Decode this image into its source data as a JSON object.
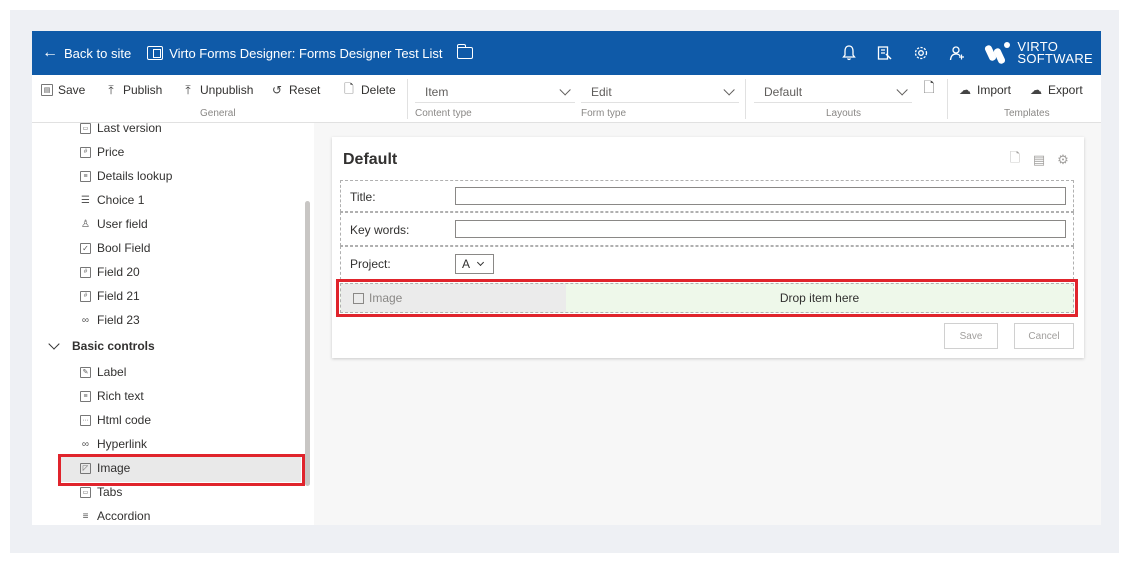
{
  "topbar": {
    "back_label": "Back to site",
    "title": "Virto Forms Designer: Forms Designer Test List",
    "icons": [
      "bell-icon",
      "reader-icon",
      "gear-icon",
      "person-icon"
    ],
    "logo_line1": "VIRTO",
    "logo_line2": "SOFTWARE",
    "background": "#0f5aa8"
  },
  "ribbon": {
    "general": {
      "title": "General",
      "save": "Save",
      "publish": "Publish",
      "unpublish": "Unpublish",
      "reset": "Reset",
      "delete": "Delete"
    },
    "content_type": {
      "title": "Content type",
      "value": "Item"
    },
    "form_type": {
      "title": "Form type",
      "value": "Edit"
    },
    "layouts": {
      "title": "Layouts",
      "value": "Default"
    },
    "templates": {
      "title": "Templates",
      "import": "Import",
      "export": "Export"
    }
  },
  "sidebar": {
    "fields": [
      {
        "label": "Last version",
        "icon": "text-field-icon"
      },
      {
        "label": "Price",
        "icon": "number-field-icon"
      },
      {
        "label": "Details lookup",
        "icon": "lookup-icon"
      },
      {
        "label": "Choice 1",
        "icon": "choice-icon"
      },
      {
        "label": "User field",
        "icon": "user-icon"
      },
      {
        "label": "Bool Field",
        "icon": "checkbox-icon"
      },
      {
        "label": "Field 20",
        "icon": "number-field-icon"
      },
      {
        "label": "Field 21",
        "icon": "number-field-icon"
      },
      {
        "label": "Field 23",
        "icon": "link-icon"
      }
    ],
    "group_label": "Basic controls",
    "controls": [
      {
        "label": "Label",
        "icon": "label-icon"
      },
      {
        "label": "Rich text",
        "icon": "rich-text-icon"
      },
      {
        "label": "Html code",
        "icon": "html-icon"
      },
      {
        "label": "Hyperlink",
        "icon": "link-icon"
      },
      {
        "label": "Image",
        "icon": "image-icon"
      },
      {
        "label": "Tabs",
        "icon": "tabs-icon"
      },
      {
        "label": "Accordion",
        "icon": "accordion-icon"
      }
    ],
    "highlight_color": "#e0242c"
  },
  "form": {
    "heading": "Default",
    "rows": [
      {
        "label": "Title:"
      },
      {
        "label": "Key words:"
      },
      {
        "label": "Project:",
        "select_value": "A"
      }
    ],
    "ghost_label": "Image",
    "drop_label": "Drop item here",
    "save": "Save",
    "cancel": "Cancel",
    "drop_bg": "#eef8ea"
  }
}
